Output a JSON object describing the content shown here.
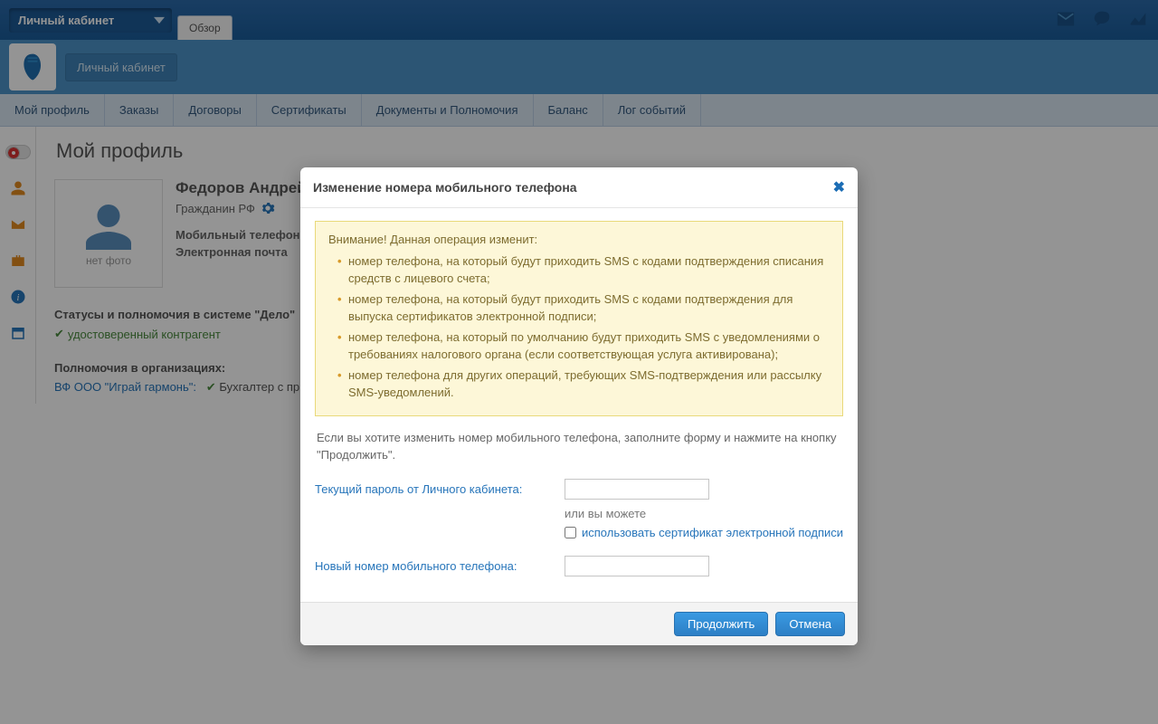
{
  "topbar": {
    "dropdown_label": "Личный кабинет",
    "tab_label": "Обзор"
  },
  "navbar": {
    "btn_label": "Личный кабинет"
  },
  "menu": {
    "items": [
      "Мой профиль",
      "Заказы",
      "Договоры",
      "Сертификаты",
      "Документы и Полномочия",
      "Баланс",
      "Лог событий"
    ]
  },
  "page": {
    "title": "Мой профиль"
  },
  "profile": {
    "avatar_placeholder": "нет фото",
    "name": "Федоров Андрей",
    "citizenship": "Гражданин РФ",
    "phone_label": "Мобильный телефон",
    "email_label": "Электронная почта",
    "status_heading": "Статусы и полномочия в системе \"Дело\"",
    "status_verified": "удостоверенный контрагент",
    "orgs_heading": "Полномочия в организациях:",
    "org_name": "ВФ ООО \"Играй гармонь\":",
    "org_role": "Бухгалтер с пр"
  },
  "modal": {
    "title": "Изменение номера мобильного телефона",
    "warning_head": "Внимание! Данная операция изменит:",
    "warning_items": [
      "номер телефона, на который будут приходить SMS с кодами подтверждения списания средств с лицевого счета;",
      "номер телефона, на который будут приходить SMS с кодами подтверждения для выпуска сертификатов электронной подписи;",
      "номер телефона, на который по умолчанию будут приходить SMS с уведомлениями о требованиях налогового органа (если соответствующая услуга активирована);",
      "номер телефона для других операций, требующих SMS-подтверждения или рассылку SMS-уведомлений."
    ],
    "description": "Если вы хотите изменить номер мобильного телефона, заполните форму и нажмите на кнопку \"Продолжить\".",
    "password_label": "Текущий пароль от Личного кабинета:",
    "or_hint": "или вы можете",
    "cert_label": "использовать сертификат электронной подписи",
    "new_phone_label": "Новый номер мобильного телефона:",
    "btn_continue": "Продолжить",
    "btn_cancel": "Отмена"
  }
}
